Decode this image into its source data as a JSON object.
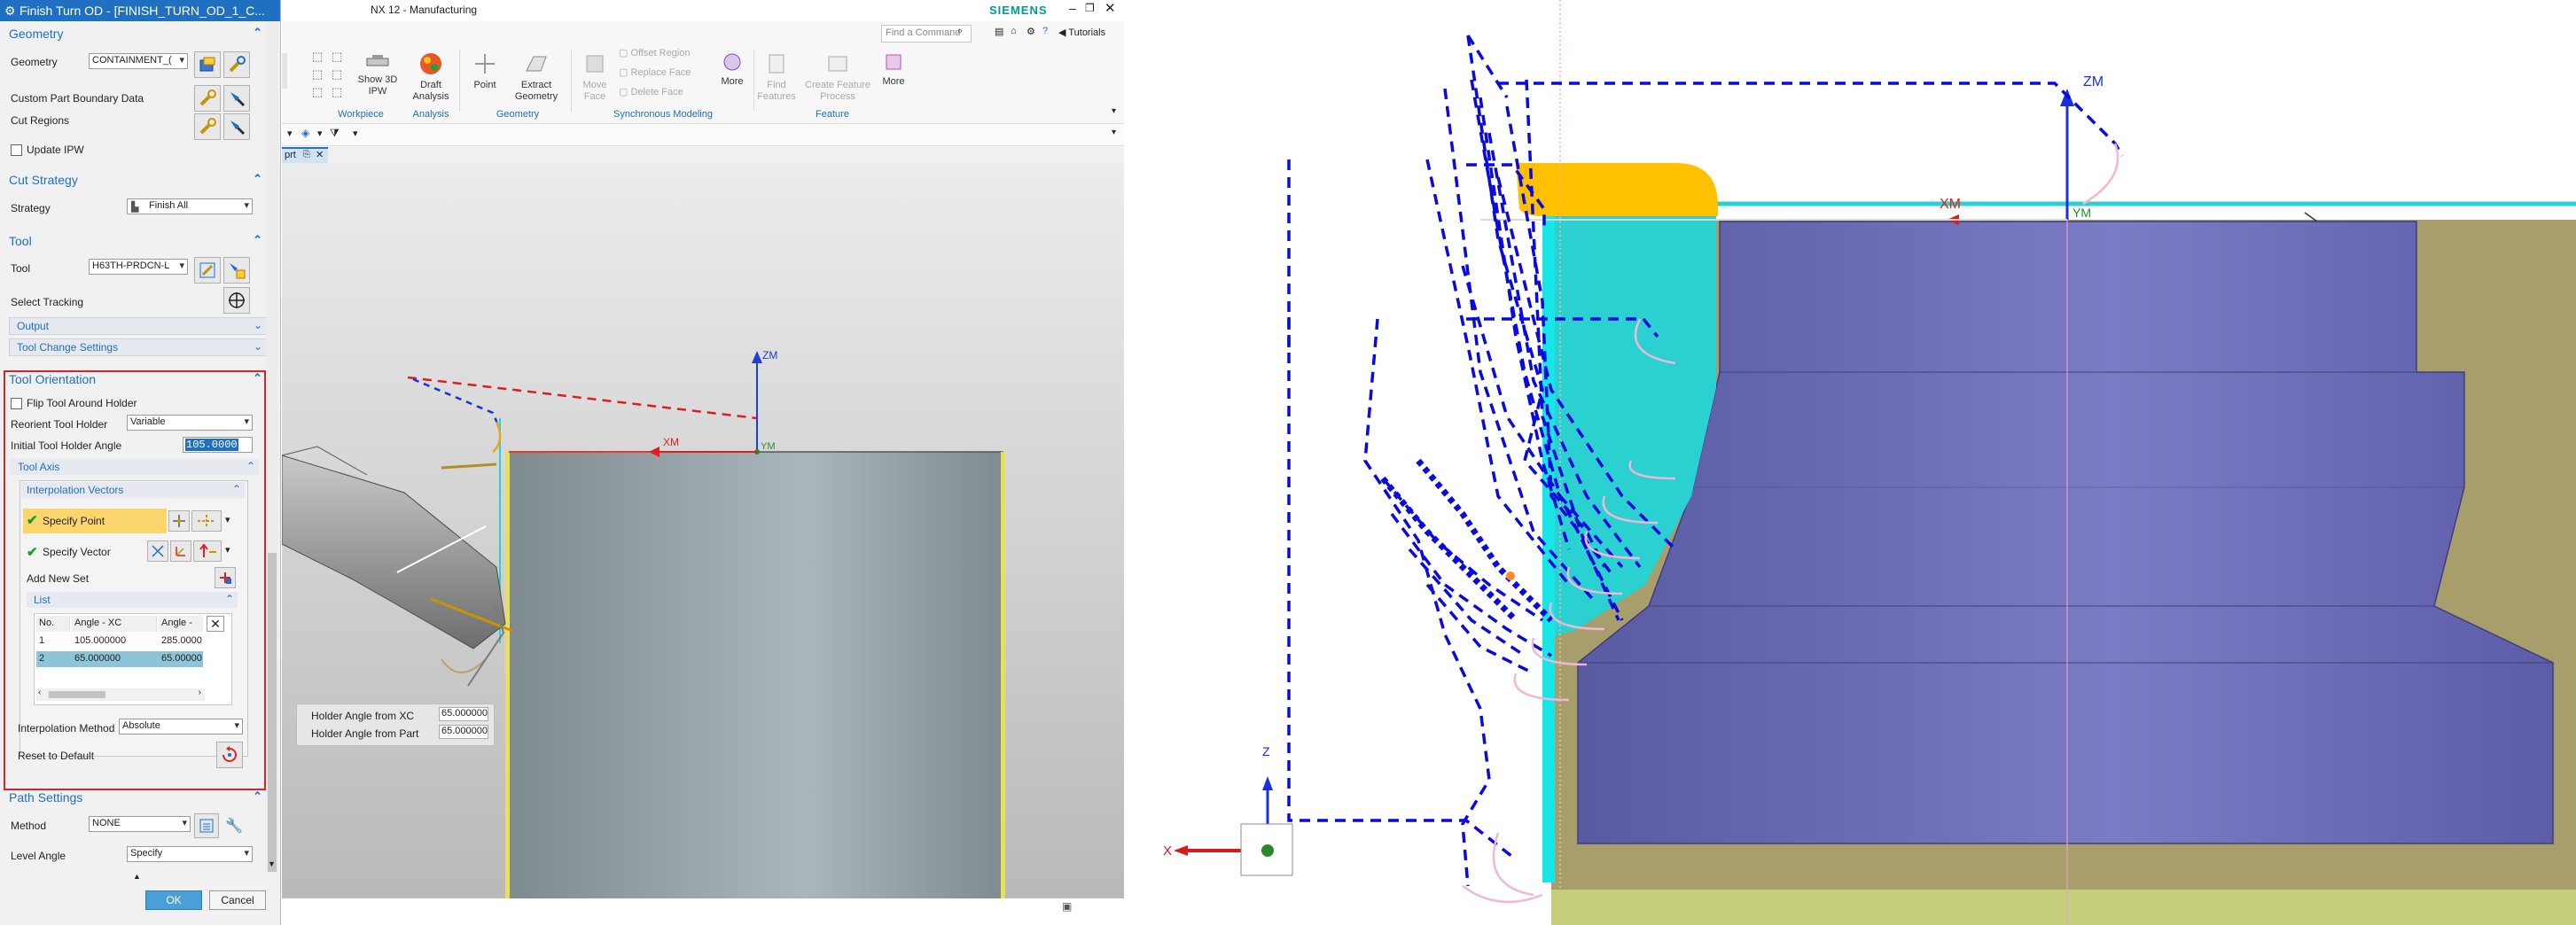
{
  "dialog": {
    "title": "Finish Turn OD - [FINISH_TURN_OD_1_C...",
    "geometry": {
      "header": "Geometry",
      "geometry_label": "Geometry",
      "geometry_value": "CONTAINMENT_(",
      "custom_part_boundary": "Custom Part Boundary Data",
      "cut_regions": "Cut Regions",
      "update_ipw": "Update IPW"
    },
    "cut_strategy": {
      "header": "Cut Strategy",
      "strategy_label": "Strategy",
      "strategy_value": "Finish All"
    },
    "tool": {
      "header": "Tool",
      "tool_label": "Tool",
      "tool_value": "H63TH-PRDCN-L",
      "select_tracking": "Select Tracking",
      "output": "Output",
      "tool_change_settings": "Tool Change Settings"
    },
    "tool_orientation": {
      "header": "Tool Orientation",
      "flip_tool": "Flip Tool Around Holder",
      "reorient_label": "Reorient Tool Holder",
      "reorient_value": "Variable",
      "initial_angle_label": "Initial Tool Holder Angle",
      "initial_angle_value": "105.0000",
      "tool_axis": "Tool Axis",
      "interpolation_vectors": "Interpolation Vectors",
      "specify_point": "Specify Point",
      "specify_vector": "Specify Vector",
      "add_new_set": "Add New Set",
      "list": "List",
      "columns": [
        "No.",
        "Angle - XC",
        "Angle -"
      ],
      "rows": [
        [
          "1",
          "105.000000",
          "285.0000"
        ],
        [
          "2",
          "65.000000",
          "65.00000"
        ]
      ],
      "interp_method_label": "Interpolation Method",
      "interp_method_value": "Absolute",
      "reset_default": "Reset to Default"
    },
    "path_settings": {
      "header": "Path Settings",
      "method_label": "Method",
      "method_value": "NONE",
      "level_angle_label": "Level Angle",
      "level_angle_value": "Specify"
    },
    "ok": "OK",
    "cancel": "Cancel"
  },
  "nx": {
    "app_title": "NX 12 - Manufacturing",
    "brand": "SIEMENS",
    "find_command": "Find a Command",
    "tutorials": "Tutorials",
    "ribbon": {
      "show_3d_ipw": "Show 3D IPW",
      "draft_analysis": "Draft Analysis",
      "point": "Point",
      "extract_geometry": "Extract Geometry",
      "move_face": "Move Face",
      "offset_region": "Offset Region",
      "replace_face": "Replace Face",
      "delete_face": "Delete Face",
      "more": "More",
      "find_features": "Find Features",
      "create_feature_process": "Create Feature Process",
      "more2": "More",
      "groups": [
        "Workpiece",
        "Analysis",
        "Geometry",
        "Synchronous Modeling",
        "Feature"
      ]
    },
    "tab_label": "prt",
    "viewport": {
      "zm": "ZM",
      "xm": "XM",
      "ym": "YM",
      "holder_xc_label": "Holder Angle from XC",
      "holder_xc_value": "65.000000",
      "holder_part_label": "Holder Angle from Part",
      "holder_part_value": "65.000000"
    }
  },
  "right_view": {
    "zm": "ZM",
    "xm": "XM",
    "ym": "YM",
    "triad_z": "Z",
    "triad_x": "X"
  },
  "colors": {
    "title_blue": "#1f6fc2",
    "highlight_red": "#d8232a",
    "toolpath_blue": "#0a0adf",
    "cyan": "#2bd1d1",
    "part_purple": "#6c6cb8",
    "stock_tan": "#a89e6b",
    "holder_gold": "#ffc000"
  }
}
